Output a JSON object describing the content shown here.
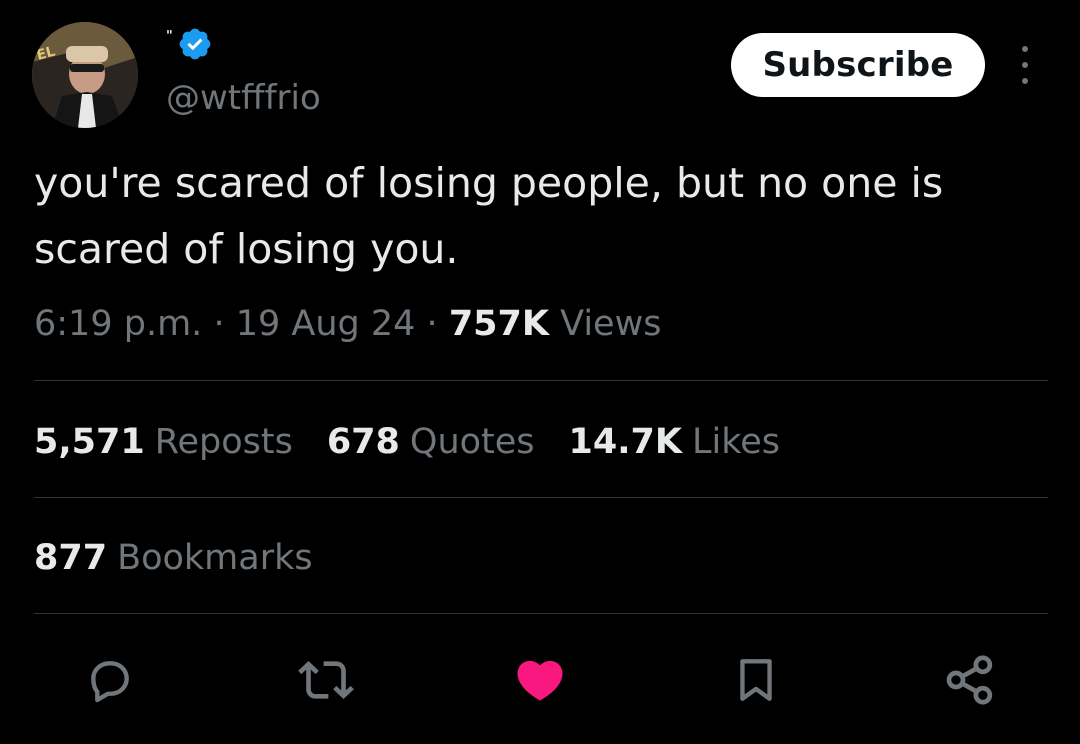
{
  "author": {
    "display_name": "\"",
    "handle": "@wtfffrio",
    "verified": true
  },
  "header": {
    "subscribe_label": "Subscribe",
    "more_icon": "more-vertical-icon"
  },
  "tweet": {
    "text": "you're scared of losing people, but no one is\nscared of losing you.",
    "time": "6:19 p.m.",
    "separator": "·",
    "date": "19 Aug 24",
    "views_count": "757K",
    "views_label": "Views"
  },
  "stats": {
    "reposts_count": "5,571",
    "reposts_label": "Reposts",
    "quotes_count": "678",
    "quotes_label": "Quotes",
    "likes_count": "14.7K",
    "likes_label": "Likes",
    "bookmarks_count": "877",
    "bookmarks_label": "Bookmarks"
  },
  "actions": {
    "icons": [
      "reply-icon",
      "repost-icon",
      "like-icon",
      "bookmark-icon",
      "share-icon"
    ],
    "liked": true
  },
  "colors": {
    "background": "#000000",
    "text_primary": "#e7e9ea",
    "text_secondary": "#71767b",
    "verified_blue": "#1d9bf0",
    "like_pink": "#f91880",
    "divider": "#2f3336"
  }
}
